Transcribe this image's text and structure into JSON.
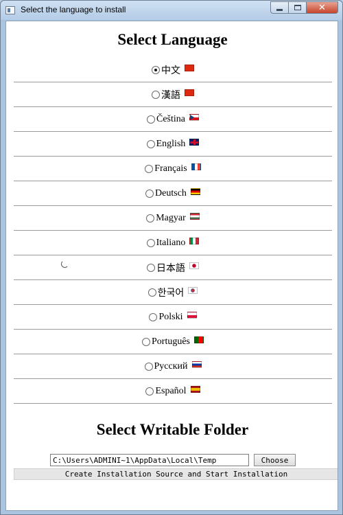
{
  "window": {
    "title": "Select the language to install",
    "icon": "app-window-icon",
    "controls": {
      "minimize": "minimize-icon",
      "maximize": "maximize-icon",
      "close": "close-icon"
    }
  },
  "language_section": {
    "heading": "Select Language",
    "selected": "中文",
    "items": [
      {
        "label": "中文",
        "flag": "cn"
      },
      {
        "label": "漢語",
        "flag": "cn"
      },
      {
        "label": "Čeština",
        "flag": "cz"
      },
      {
        "label": "English",
        "flag": "gb"
      },
      {
        "label": "Français",
        "flag": "fr"
      },
      {
        "label": "Deutsch",
        "flag": "de"
      },
      {
        "label": "Magyar",
        "flag": "hu"
      },
      {
        "label": "Italiano",
        "flag": "it"
      },
      {
        "label": "日本語",
        "flag": "jp"
      },
      {
        "label": "한국어",
        "flag": "kr"
      },
      {
        "label": "Polski",
        "flag": "pl"
      },
      {
        "label": "Português",
        "flag": "pt"
      },
      {
        "label": "Русский",
        "flag": "ru"
      },
      {
        "label": "Español",
        "flag": "es"
      }
    ]
  },
  "folder_section": {
    "heading": "Select Writable Folder",
    "path_value": "C:\\Users\\ADMINI~1\\AppData\\Local\\Temp",
    "choose_label": "Choose",
    "start_label": "Create Installation Source and Start Installation"
  },
  "colors": {
    "accent": "#de2910",
    "titlebar": "#b9d1ea",
    "close": "#c7442b"
  }
}
